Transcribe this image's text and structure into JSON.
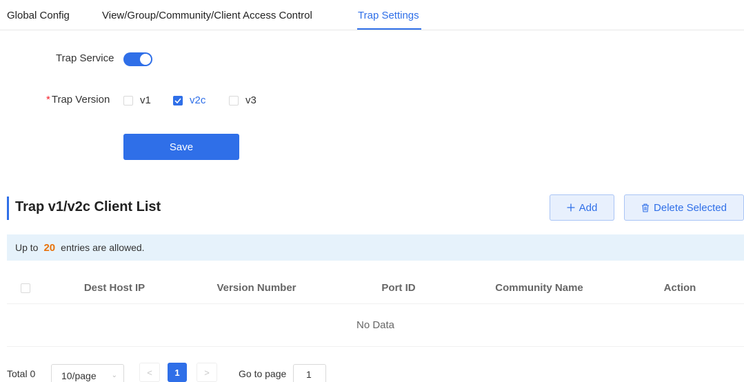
{
  "tabs": [
    {
      "label": "Global Config",
      "active": false
    },
    {
      "label": "View/Group/Community/Client Access Control",
      "active": false
    },
    {
      "label": "Trap Settings",
      "active": true
    }
  ],
  "form": {
    "trap_service_label": "Trap Service",
    "trap_service_enabled": true,
    "trap_version_required_mark": "*",
    "trap_version_label": "Trap Version",
    "versions": [
      {
        "label": "v1",
        "checked": false
      },
      {
        "label": "v2c",
        "checked": true
      },
      {
        "label": "v3",
        "checked": false
      }
    ],
    "save_label": "Save"
  },
  "client_list": {
    "title": "Trap v1/v2c Client List",
    "add_label": "Add",
    "delete_label": "Delete Selected",
    "notice_prefix": "Up to",
    "notice_count": "20",
    "notice_suffix": "entries are allowed.",
    "columns": [
      "Dest Host IP",
      "Version Number",
      "Port ID",
      "Community Name",
      "Action"
    ],
    "rows": [],
    "empty_text": "No Data"
  },
  "pagination": {
    "total_label": "Total 0",
    "page_size": "10/page",
    "current_page": "1",
    "goto_label": "Go to page",
    "goto_value": "1"
  },
  "colors": {
    "accent": "#2f6fe8",
    "notice_bg": "#e6f2fb",
    "notice_number": "#e8720c",
    "required": "#f5222d"
  }
}
